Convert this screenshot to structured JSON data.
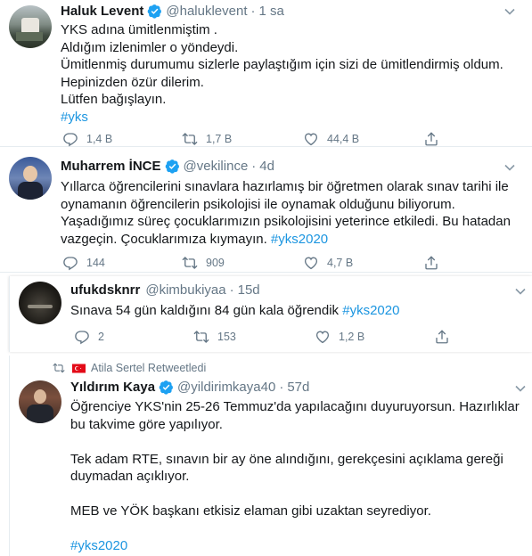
{
  "tweets": [
    {
      "name": "Haluk Levent",
      "handle": "@haluklevent",
      "separator": "·",
      "time": "1 sa",
      "lines": [
        "YKS adına ümitlenmiştim .",
        "Aldığım izlenimler o yöndeydi.",
        "Ümitlenmiş durumumu sizlerle paylaştığım için sizi de ümitlendirmiş oldum.",
        "Hepinizden özür dilerim.",
        "Lütfen bağışlayın."
      ],
      "hashtag": "#yks",
      "replies": "1,4 B",
      "retweets": "1,7 B",
      "likes": "44,4 B"
    },
    {
      "name": "Muharrem İNCE",
      "handle": "@vekilince",
      "separator": "·",
      "time": "4d",
      "line1": "Yıllarca öğrencilerini sınavlara hazırlamış bir öğretmen olarak sınav tarihi ile",
      "line2": "oynamanın öğrencilerin psikolojisi ile oynamak olduğunu biliyorum.",
      "line3": "Yaşadığımız süreç çocuklarımızın psikolojisini yeterince etkiledi. Bu hatadan",
      "line4_text": "vazgeçin. Çocuklarımıza kıymayın. ",
      "line4_hash": "#yks2020",
      "replies": "144",
      "retweets": "909",
      "likes": "4,7 B"
    },
    {
      "name": "ufukdsknrr",
      "handle": "@kimbukiyaa",
      "separator": "·",
      "time": "15d",
      "text": "Sınava 54 gün kaldığını 84 gün kala öğrendik ",
      "hashtag": "#yks2020",
      "replies": "2",
      "retweets": "153",
      "likes": "1,2 B"
    },
    {
      "retweet_banner": "Atila Sertel Retweetledi",
      "name": "Yıldırım Kaya",
      "handle": "@yildirimkaya40",
      "separator": "·",
      "time": "57d",
      "lines": [
        "Öğrenciye YKS'nin 25-26 Temmuz'da yapılacağını duyuruyorsun. Hazırlıklar",
        "bu takvime göre yapılıyor.",
        "",
        "Tek adam RTE, sınavın bir ay öne alındığını, gerekçesini açıklama gereği",
        "duymadan açıklıyor.",
        "",
        "MEB ve YÖK başkanı etkisiz elaman gibi uzaktan seyrediyor.",
        ""
      ],
      "hashtag": "#yks2020"
    }
  ],
  "colors": {
    "link": "#1b95e0",
    "secondary": "#657786",
    "verified": "#1da1f2",
    "flag": "#e30a17"
  },
  "icons": [
    "reply-icon",
    "retweet-icon",
    "like-icon",
    "share-icon",
    "verified-icon",
    "chevron-down-icon",
    "retweet-banner-icon",
    "turkey-flag-icon"
  ]
}
